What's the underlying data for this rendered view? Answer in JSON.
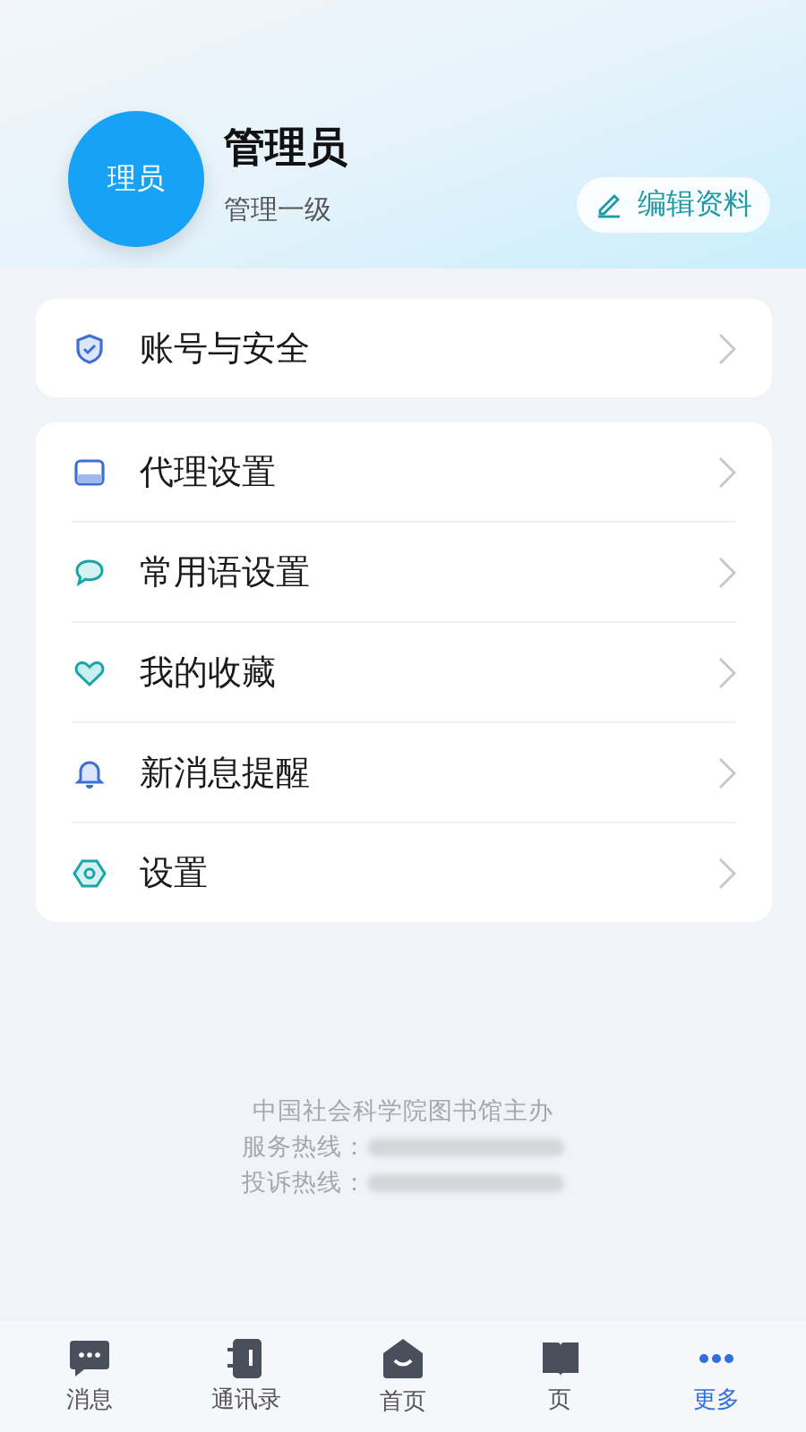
{
  "profile": {
    "avatar_text": "理员",
    "name": "管理员",
    "role": "管理一级",
    "edit_button": "编辑资料"
  },
  "groups": [
    [
      {
        "label": "账号与安全"
      }
    ],
    [
      {
        "label": "代理设置"
      },
      {
        "label": "常用语设置"
      },
      {
        "label": "我的收藏"
      },
      {
        "label": "新消息提醒"
      },
      {
        "label": "设置"
      }
    ]
  ],
  "footer": {
    "sponsor": "中国社会科学院图书馆主办",
    "hotlines": [
      {
        "label": "服务热线："
      },
      {
        "label": "投诉热线："
      }
    ]
  },
  "tab_bar": [
    {
      "label": "消息",
      "selected": false
    },
    {
      "label": "通讯录",
      "selected": false
    },
    {
      "label": "首页",
      "selected": false
    },
    {
      "label": "页",
      "selected": false
    },
    {
      "label": "更多",
      "selected": true
    }
  ]
}
